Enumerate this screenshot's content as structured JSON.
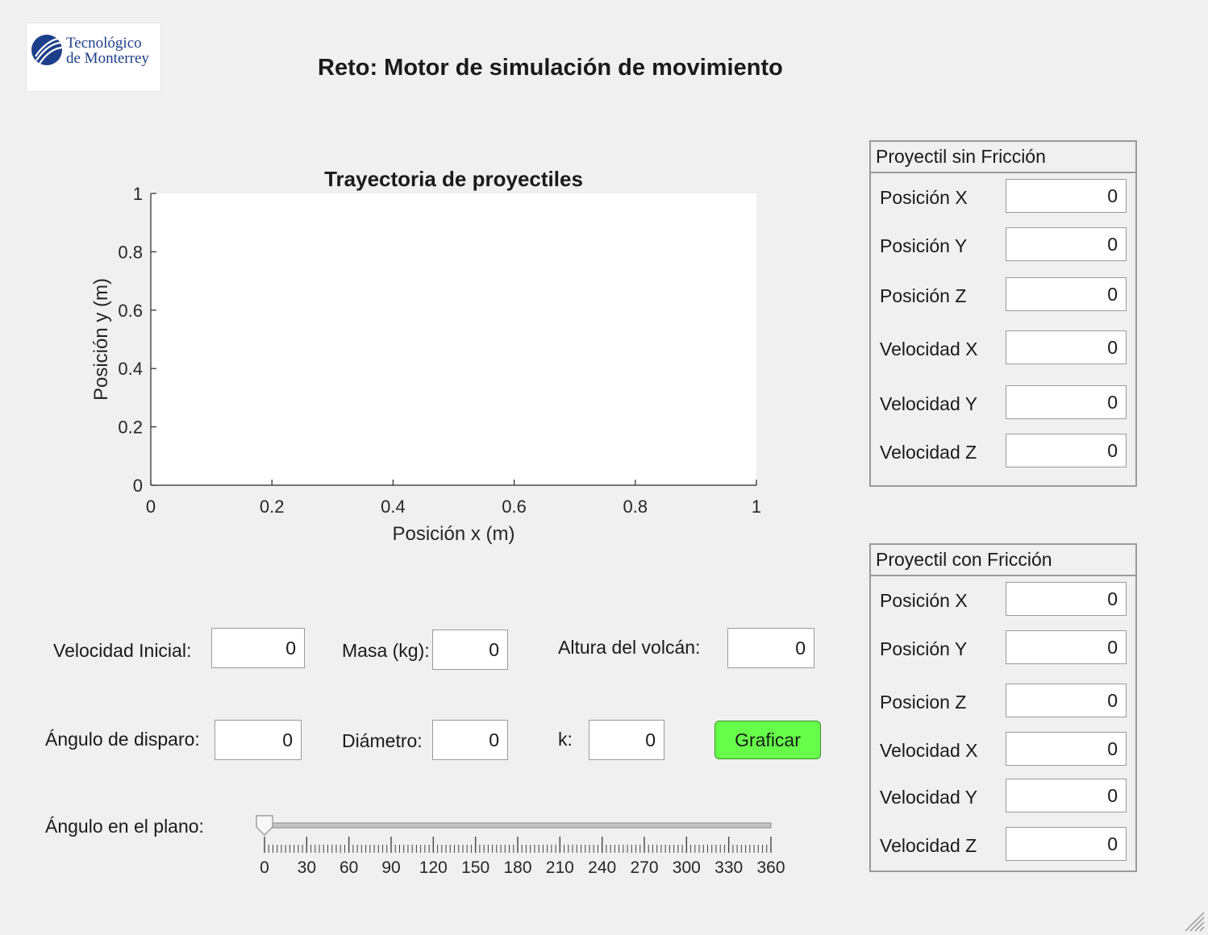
{
  "app": {
    "title": "Reto: Motor de simulación de movimiento",
    "logo_line1": "Tecnológico",
    "logo_line2": "de Monterrey"
  },
  "chart_data": {
    "type": "line",
    "title": "Trayectoria de proyectiles",
    "xlabel": "Posición x (m)",
    "ylabel": "Posición y (m)",
    "xlim": [
      0,
      1
    ],
    "ylim": [
      0,
      1
    ],
    "x_ticks": [
      "0",
      "0.2",
      "0.4",
      "0.6",
      "0.8",
      "1"
    ],
    "y_ticks": [
      "0",
      "0.2",
      "0.4",
      "0.6",
      "0.8",
      "1"
    ],
    "series": [],
    "grid": false
  },
  "inputs": {
    "velocidad_inicial": {
      "label": "Velocidad Inicial:",
      "value": "0"
    },
    "masa": {
      "label": "Masa (kg):",
      "value": "0"
    },
    "altura": {
      "label": "Altura del volcán:",
      "value": "0"
    },
    "angulo_disparo": {
      "label": "Ángulo de disparo:",
      "value": "0"
    },
    "diametro": {
      "label": "Diámetro:",
      "value": "0"
    },
    "k": {
      "label": "k:",
      "value": "0"
    },
    "graficar": {
      "label": "Graficar",
      "color": "#66ff4a"
    }
  },
  "slider": {
    "label": "Ángulo en el plano:",
    "value": 0,
    "min": 0,
    "max": 360,
    "tick_labels": [
      "0",
      "30",
      "60",
      "90",
      "120",
      "150",
      "180",
      "210",
      "240",
      "270",
      "300",
      "330",
      "360"
    ]
  },
  "panel_sin": {
    "title": "Proyectil sin Fricción",
    "rows": [
      {
        "label": "Posición X",
        "value": "0"
      },
      {
        "label": "Posición Y",
        "value": "0"
      },
      {
        "label": "Posición Z",
        "value": "0"
      },
      {
        "label": "Velocidad X",
        "value": "0"
      },
      {
        "label": "Velocidad Y",
        "value": "0"
      },
      {
        "label": "Velocidad Z",
        "value": "0"
      }
    ]
  },
  "panel_con": {
    "title": "Proyectil con Fricción",
    "rows": [
      {
        "label": "Posición X",
        "value": "0"
      },
      {
        "label": "Posición Y",
        "value": "0"
      },
      {
        "label": "Posicion Z",
        "value": "0"
      },
      {
        "label": "Velocidad X",
        "value": "0"
      },
      {
        "label": "Velocidad Y",
        "value": "0"
      },
      {
        "label": "Velocidad Z",
        "value": "0"
      }
    ]
  },
  "icons": {
    "logo": "tec-monterrey-logo-icon",
    "resize": "resize-grip-icon"
  }
}
